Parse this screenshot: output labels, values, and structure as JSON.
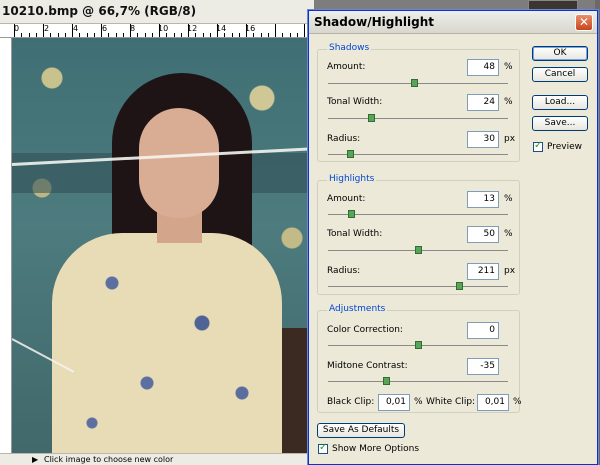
{
  "document": {
    "title": "10210.bmp @ 66,7% (RGB/8)",
    "ruler_numbers": [
      "0",
      "2",
      "4",
      "6",
      "8",
      "10",
      "12",
      "14",
      "16"
    ],
    "status_text": "Click image to choose new color"
  },
  "dialog": {
    "title": "Shadow/Highlight",
    "close_glyph": "✕",
    "shadows": {
      "label": "Shadows",
      "amount": {
        "label": "Amount:",
        "value": "48",
        "unit": "%",
        "slider_fraction": 0.48
      },
      "tonal_width": {
        "label": "Tonal Width:",
        "value": "24",
        "unit": "%",
        "slider_fraction": 0.24
      },
      "radius": {
        "label": "Radius:",
        "value": "30",
        "unit": "px",
        "slider_fraction": 0.12
      }
    },
    "highlights": {
      "label": "Highlights",
      "amount": {
        "label": "Amount:",
        "value": "13",
        "unit": "%",
        "slider_fraction": 0.13
      },
      "tonal_width": {
        "label": "Tonal Width:",
        "value": "50",
        "unit": "%",
        "slider_fraction": 0.5
      },
      "radius": {
        "label": "Radius:",
        "value": "211",
        "unit": "px",
        "slider_fraction": 0.73
      }
    },
    "adjustments": {
      "label": "Adjustments",
      "color_correction": {
        "label": "Color Correction:",
        "value": "0",
        "slider_fraction": 0.5
      },
      "midtone_contrast": {
        "label": "Midtone Contrast:",
        "value": "-35",
        "slider_fraction": 0.32
      },
      "black_clip": {
        "label": "Black Clip:",
        "value": "0,01",
        "unit": "%"
      },
      "white_clip": {
        "label": "White Clip:",
        "value": "0,01",
        "unit": "%"
      }
    },
    "buttons": {
      "ok": "OK",
      "cancel": "Cancel",
      "load": "Load...",
      "save": "Save..."
    },
    "preview": {
      "label": "Preview",
      "checked": true
    },
    "save_defaults": "Save As Defaults",
    "show_more": {
      "label": "Show More Options",
      "checked": true
    }
  },
  "colors": {
    "accent": "#0046d5",
    "dialog_bg": "#ece9d8",
    "slider_thumb": "#5aa35a"
  }
}
